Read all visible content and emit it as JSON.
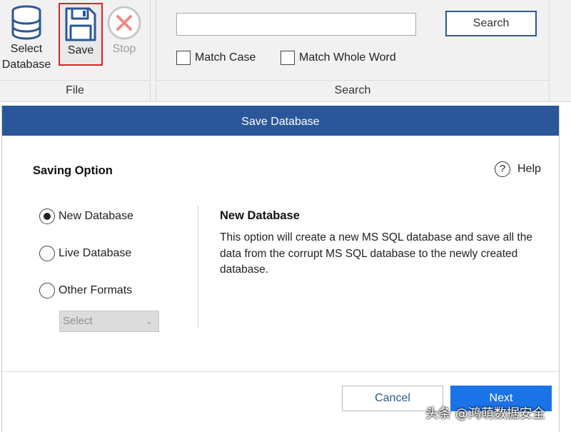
{
  "ribbon": {
    "file_group": {
      "caption": "File",
      "select_database": {
        "line1": "Select",
        "line2": "Database",
        "icon": "database-icon"
      },
      "save": {
        "label": "Save",
        "icon": "floppy-disk-icon"
      },
      "stop": {
        "label": "Stop",
        "icon": "stop-x-icon"
      }
    },
    "search_group": {
      "caption": "Search",
      "search_value": "",
      "search_button": "Search",
      "match_case": "Match Case",
      "match_whole_word": "Match Whole Word"
    }
  },
  "dialog": {
    "title": "Save Database",
    "section_title": "Saving Option",
    "help_label": "Help",
    "options": [
      {
        "label": "New Database",
        "selected": true
      },
      {
        "label": "Live Database",
        "selected": false
      },
      {
        "label": "Other Formats",
        "selected": false
      }
    ],
    "format_select": "Select",
    "description_title": "New Database",
    "description_text": "This option will create a new MS SQL database and save all the data from the corrupt MS SQL database to the newly created database.",
    "cancel_button": "Cancel",
    "next_button": "Next"
  },
  "watermark": "头条 @鸿萌数据安全",
  "colors": {
    "header": "#2a5799",
    "primary": "#1b73e8",
    "highlight": "#d9252a"
  }
}
